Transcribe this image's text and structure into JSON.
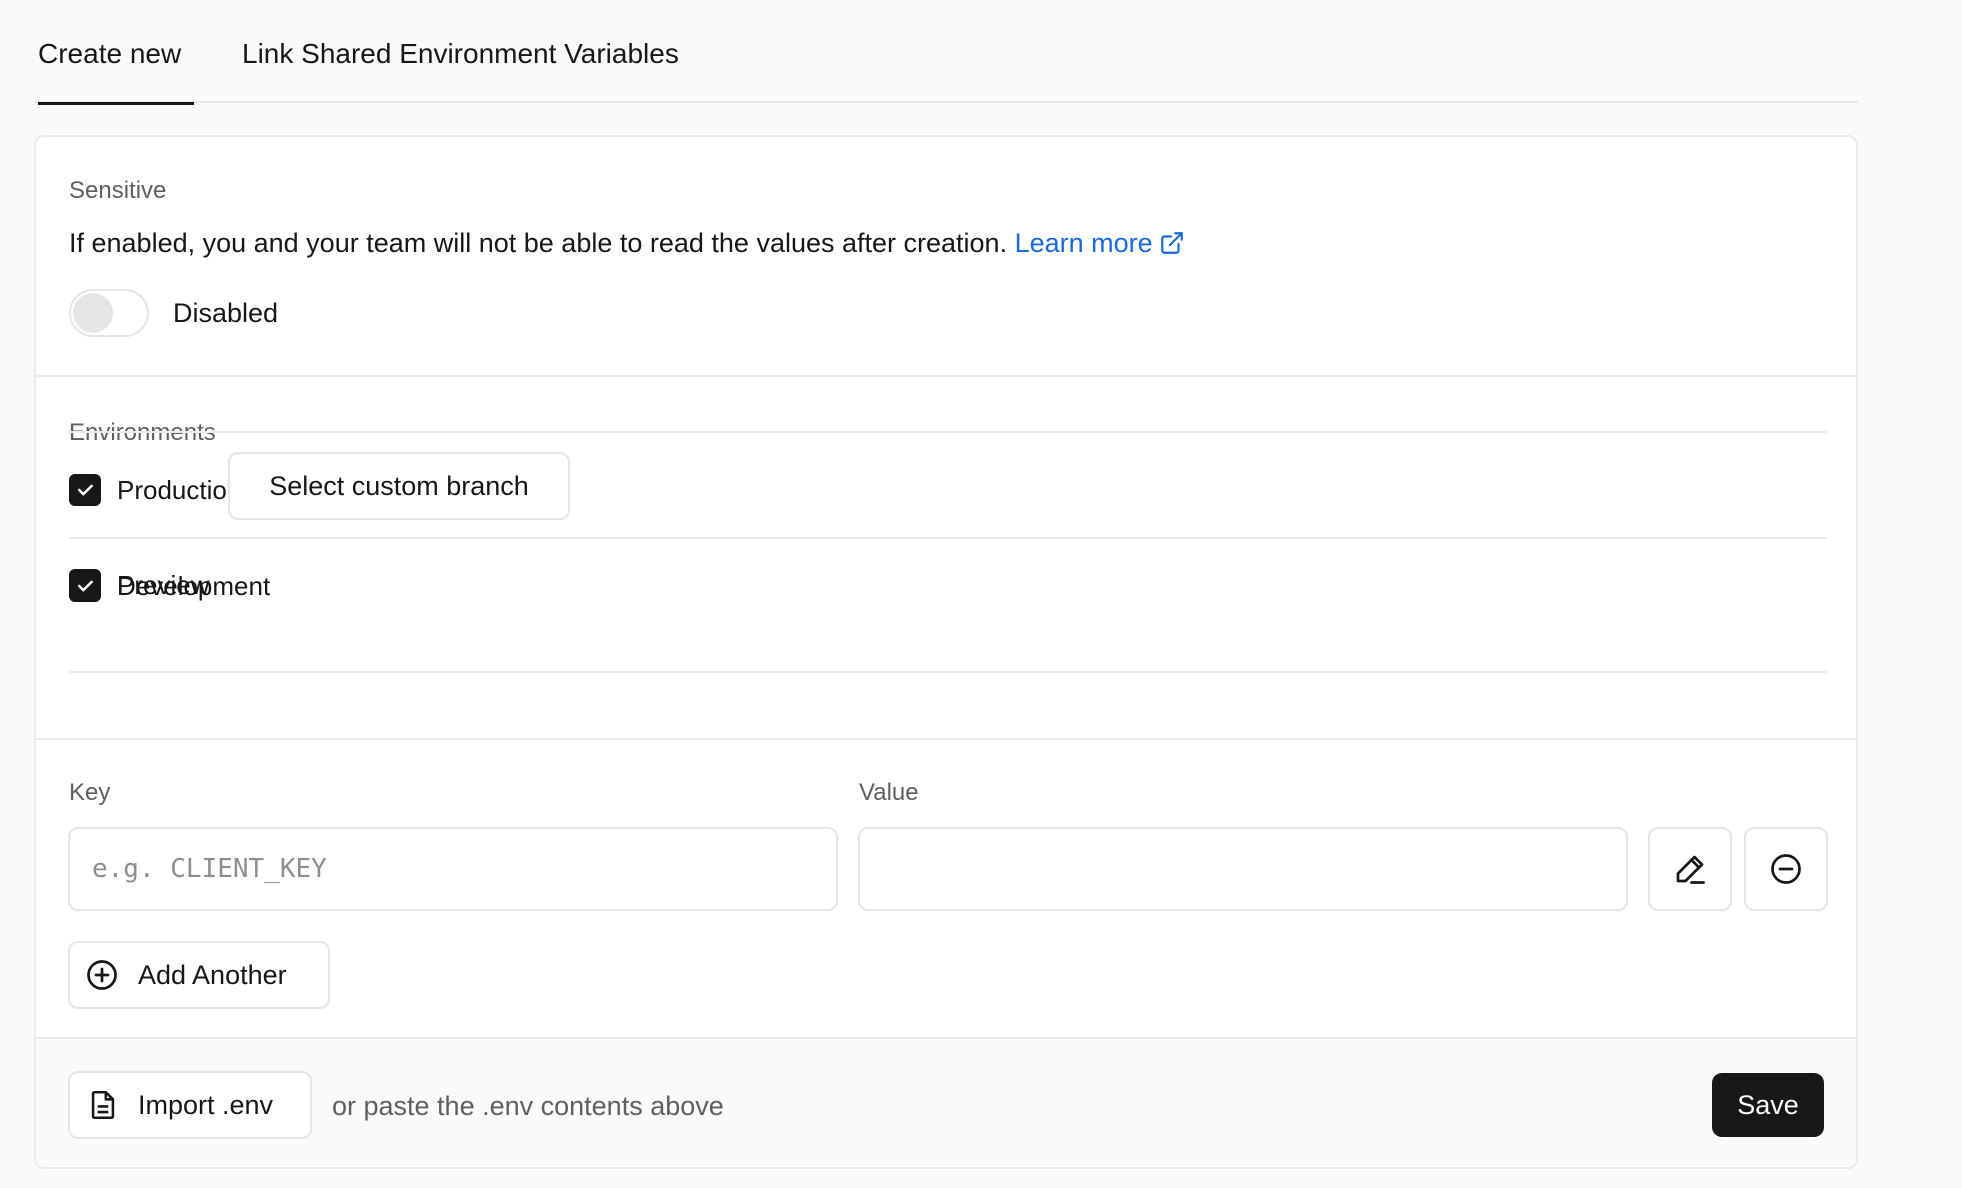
{
  "tabs": [
    {
      "label": "Create new",
      "active": true
    },
    {
      "label": "Link Shared Environment Variables",
      "active": false
    }
  ],
  "sensitive": {
    "title": "Sensitive",
    "description": "If enabled, you and your team will not be able to read the values after creation.",
    "learn_more": "Learn more",
    "toggle_state": "Disabled",
    "enabled": false
  },
  "environments": {
    "title": "Environments",
    "items": [
      {
        "label": "Production",
        "checked": true
      },
      {
        "label": "Preview",
        "checked": true
      },
      {
        "label": "Development",
        "checked": true
      }
    ],
    "custom_branch_label": "Select custom branch"
  },
  "variables": {
    "key_label": "Key",
    "value_label": "Value",
    "key_placeholder": "e.g. CLIENT_KEY",
    "key_value": "",
    "value_value": "",
    "add_another_label": "Add Another"
  },
  "footer": {
    "import_label": "Import .env",
    "hint": "or paste the .env contents above",
    "save_label": "Save"
  },
  "colors": {
    "link": "#1a6ad8",
    "primary": "#171717",
    "border": "#e5e5e5"
  }
}
